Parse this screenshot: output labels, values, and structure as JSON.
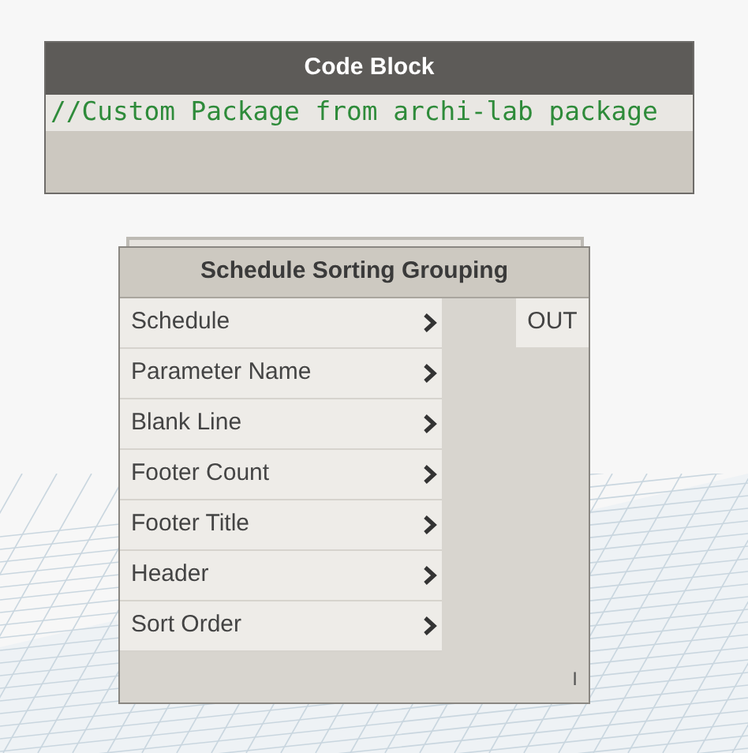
{
  "code_block": {
    "title": "Code Block",
    "code": "//Custom Package from archi-lab package"
  },
  "node": {
    "title": "Schedule Sorting Grouping",
    "inputs": [
      {
        "label": "Schedule"
      },
      {
        "label": "Parameter Name"
      },
      {
        "label": "Blank Line"
      },
      {
        "label": "Footer Count"
      },
      {
        "label": "Footer Title"
      },
      {
        "label": "Header"
      },
      {
        "label": "Sort Order"
      }
    ],
    "outputs": [
      {
        "label": "OUT"
      }
    ],
    "lacing": "I"
  }
}
